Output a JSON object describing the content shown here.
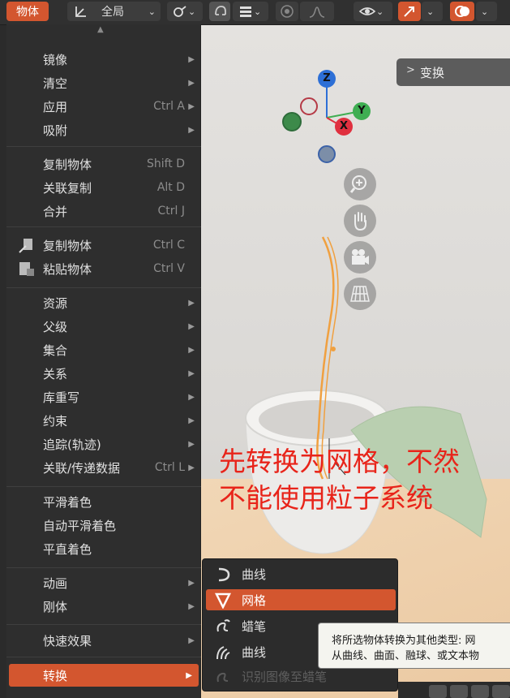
{
  "header": {
    "object_menu": "物体",
    "transform_orientation": "全局"
  },
  "menu": {
    "up_arrow": "▲",
    "items": [
      {
        "label": "镜像",
        "shortcut": "",
        "has_submenu": true
      },
      {
        "label": "清空",
        "shortcut": "",
        "has_submenu": true
      },
      {
        "label": "应用",
        "shortcut": "Ctrl A",
        "has_submenu": true
      },
      {
        "label": "吸附",
        "shortcut": "",
        "has_submenu": true
      },
      {
        "label": "复制物体",
        "shortcut": "Shift D",
        "has_submenu": false
      },
      {
        "label": "关联复制",
        "shortcut": "Alt D",
        "has_submenu": false
      },
      {
        "label": "合并",
        "shortcut": "Ctrl J",
        "has_submenu": false
      },
      {
        "label": "复制物体",
        "shortcut": "Ctrl C",
        "has_submenu": false
      },
      {
        "label": "粘贴物体",
        "shortcut": "Ctrl V",
        "has_submenu": false
      },
      {
        "label": "资源",
        "shortcut": "",
        "has_submenu": true
      },
      {
        "label": "父级",
        "shortcut": "",
        "has_submenu": true
      },
      {
        "label": "集合",
        "shortcut": "",
        "has_submenu": true
      },
      {
        "label": "关系",
        "shortcut": "",
        "has_submenu": true
      },
      {
        "label": "库重写",
        "shortcut": "",
        "has_submenu": true
      },
      {
        "label": "约束",
        "shortcut": "",
        "has_submenu": true
      },
      {
        "label": "追踪(轨迹)",
        "shortcut": "",
        "has_submenu": true
      },
      {
        "label": "关联/传递数据",
        "shortcut": "Ctrl L",
        "has_submenu": true
      },
      {
        "label": "平滑着色",
        "shortcut": "",
        "has_submenu": false
      },
      {
        "label": "自动平滑着色",
        "shortcut": "",
        "has_submenu": false
      },
      {
        "label": "平直着色",
        "shortcut": "",
        "has_submenu": false
      },
      {
        "label": "动画",
        "shortcut": "",
        "has_submenu": true
      },
      {
        "label": "刚体",
        "shortcut": "",
        "has_submenu": true
      },
      {
        "label": "快速效果",
        "shortcut": "",
        "has_submenu": true
      },
      {
        "label": "转换",
        "shortcut": "",
        "has_submenu": true
      }
    ]
  },
  "submenu": {
    "items": [
      {
        "label": "曲线",
        "icon": "curve-icon"
      },
      {
        "label": "网格",
        "icon": "mesh-icon"
      },
      {
        "label": "蜡笔",
        "icon": "grease-pencil-icon"
      },
      {
        "label": "曲线",
        "icon": "curves-hair-icon"
      },
      {
        "label": "识别图像至蜡笔",
        "icon": "trace-image-icon"
      }
    ]
  },
  "tooltip": {
    "line1": "将所选物体转换为其他类型: 网",
    "line2": "从曲线、曲面、融球、或文本物"
  },
  "annotation": {
    "line1": "先转换为网格，不然",
    "line2": "不能使用粒子系统"
  },
  "viewport": {
    "transform_tab": "变换",
    "gizmo": {
      "z": "Z",
      "y": "Y",
      "x": "X"
    }
  },
  "colors": {
    "accent": "#d3562f",
    "annotation": "#e8241a",
    "axis_x": "#e0303f",
    "axis_y": "#3fae52",
    "axis_z": "#2d6fd6"
  }
}
